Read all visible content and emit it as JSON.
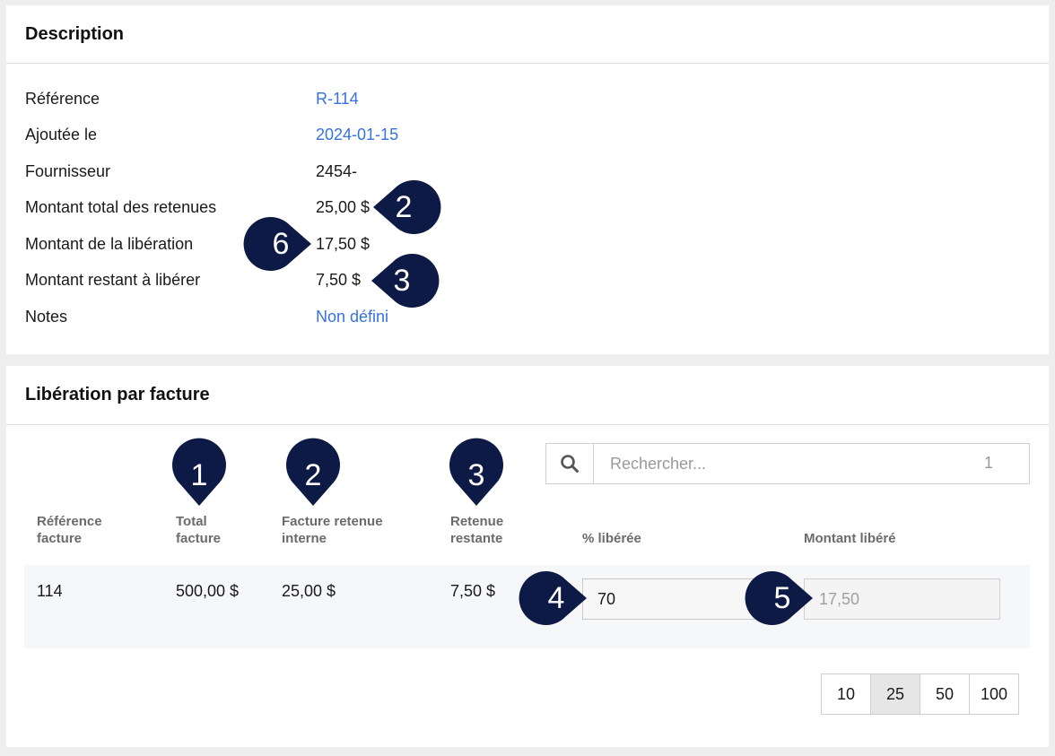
{
  "description": {
    "title": "Description",
    "rows": [
      {
        "label": "Référence",
        "value": "R-114"
      },
      {
        "label": "Ajoutée le",
        "value": "2024-01-15"
      },
      {
        "label": "Fournisseur",
        "value": "2454-"
      },
      {
        "label": "Montant total des retenues",
        "value": "25,00 $"
      },
      {
        "label": "Montant de la libération",
        "value": "17,50 $"
      },
      {
        "label": "Montant restant à libérer",
        "value": "7,50 $"
      },
      {
        "label": "Notes",
        "value": "Non défini"
      }
    ]
  },
  "liberation": {
    "title": "Libération par facture",
    "search": {
      "placeholder": "Rechercher...",
      "count": "1"
    },
    "columns": {
      "ref": [
        "Référence",
        "facture"
      ],
      "total": [
        "Total",
        "facture"
      ],
      "internal": [
        "Facture retenue",
        "interne"
      ],
      "remaining": [
        "Retenue",
        "restante"
      ],
      "percent": "% libérée",
      "amount": "Montant libéré"
    },
    "row": {
      "ref": "114",
      "total": "500,00 $",
      "internal": "25,00 $",
      "remaining": "7,50 $",
      "percent": "70",
      "amount": "17,50"
    },
    "page_sizes": [
      "10",
      "25",
      "50",
      "100"
    ],
    "active_page_size": "25"
  },
  "markers": {
    "m1": "1",
    "m2a": "2",
    "m2b": "2",
    "m3a": "3",
    "m3b": "3",
    "m4": "4",
    "m5": "5",
    "m6": "6",
    "color": "#0d1a45"
  },
  "icons": {
    "search": "search-icon"
  }
}
